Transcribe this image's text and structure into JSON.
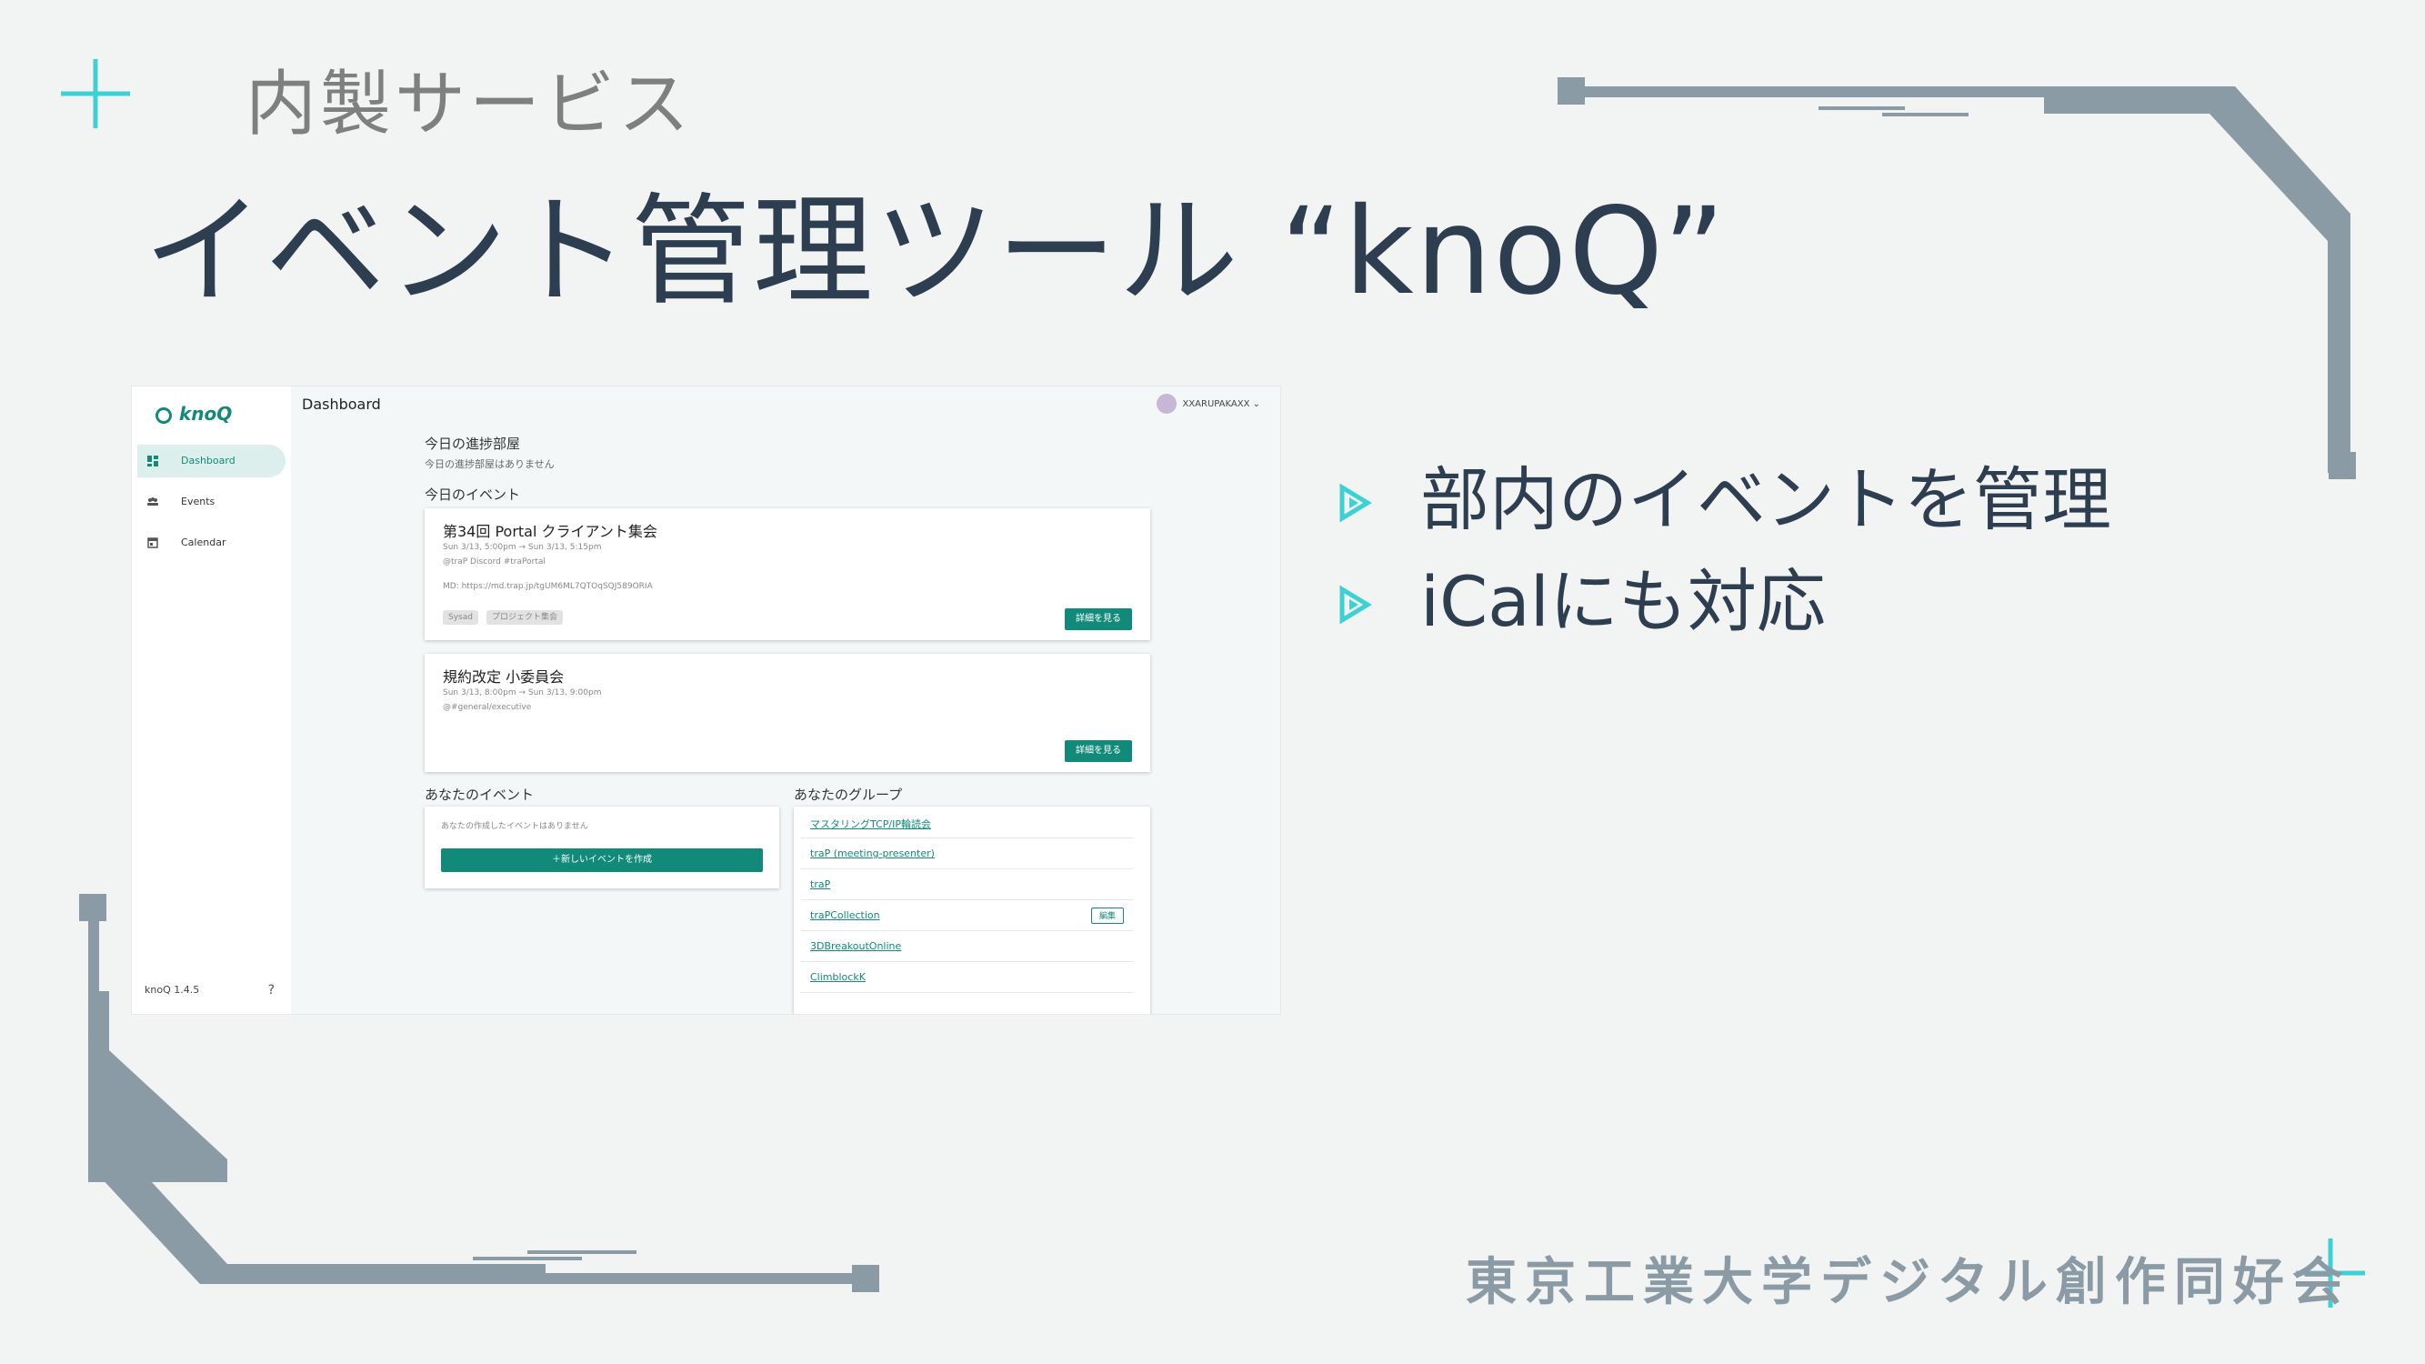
{
  "slide": {
    "subtitle": "内製サービス",
    "title": "イベント管理ツール “knoQ”",
    "bullets": [
      "部内のイベントを管理",
      "iCalにも対応"
    ],
    "footer": "東京工業大学デジタル創作同好会"
  },
  "colors": {
    "accent": "#3dd1d4",
    "circuit": "#8a9ba5",
    "title": "#2c3e50",
    "app_primary": "#128a7a"
  },
  "app": {
    "logo": "knoQ",
    "nav": [
      {
        "label": "Dashboard",
        "icon": "dashboard-icon",
        "active": true
      },
      {
        "label": "Events",
        "icon": "people-icon",
        "active": false
      },
      {
        "label": "Calendar",
        "icon": "calendar-icon",
        "active": false
      }
    ],
    "version": "knoQ 1.4.5",
    "help": "?",
    "page_title": "Dashboard",
    "user": "XXARUPAKAXX",
    "today_room": {
      "heading": "今日の進捗部屋",
      "empty": "今日の進捗部屋はありません"
    },
    "today_events": {
      "heading": "今日のイベント",
      "cards": [
        {
          "title": "第34回 Portal クライアント集会",
          "time": "Sun 3/13, 5:00pm → Sun 3/13, 5:15pm",
          "place": "@traP Discord #traPortal",
          "desc": "MD: https://md.trap.jp/tgUM6ML7QTOqSQJ589ORIA",
          "tags": [
            "Sysad",
            "プロジェクト集会"
          ],
          "button": "詳細を見る"
        },
        {
          "title": "規約改定 小委員会",
          "time": "Sun 3/13, 8:00pm → Sun 3/13, 9:00pm",
          "place": "@#general/executive",
          "button": "詳細を見る"
        }
      ]
    },
    "your_events": {
      "heading": "あなたのイベント",
      "empty": "あなたの作成したイベントはありません",
      "create_button": "＋新しいイベントを作成"
    },
    "your_groups": {
      "heading": "あなたのグループ",
      "items": [
        {
          "name": "マスタリングTCP/IP輪読会",
          "edit": ""
        },
        {
          "name": "traP (meeting-presenter)",
          "edit": ""
        },
        {
          "name": "traP",
          "edit": ""
        },
        {
          "name": "traPCollection",
          "edit": "編集"
        },
        {
          "name": "3DBreakoutOnline",
          "edit": ""
        },
        {
          "name": "ClimblockK",
          "edit": ""
        }
      ]
    }
  }
}
